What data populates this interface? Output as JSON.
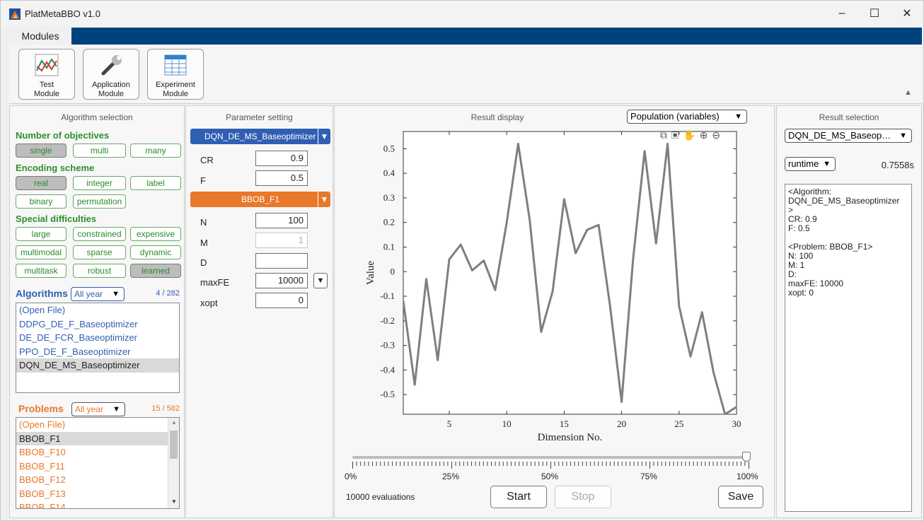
{
  "window": {
    "title": "PlatMetaBBO v1.0"
  },
  "ribbon": {
    "tab": "Modules",
    "buttons": [
      {
        "line1": "Test",
        "line2": "Module"
      },
      {
        "line1": "Application",
        "line2": "Module"
      },
      {
        "line1": "Experiment",
        "line2": "Module"
      }
    ]
  },
  "algorithm_selection": {
    "title": "Algorithm selection",
    "objectives": {
      "label": "Number of objectives",
      "tags": [
        "single",
        "multi",
        "many"
      ]
    },
    "encoding": {
      "label": "Encoding scheme",
      "tags": [
        "real",
        "integer",
        "label",
        "binary",
        "permutation"
      ]
    },
    "special": {
      "label": "Special difficulties",
      "tags": [
        "large",
        "constrained",
        "expensive",
        "multimodal",
        "sparse",
        "dynamic",
        "multitask",
        "robust",
        "learned"
      ]
    },
    "algorithms": {
      "label": "Algorithms",
      "filter": "All year",
      "count": "4 / 282",
      "items": [
        "(Open File)",
        "DDPG_DE_F_Baseoptimizer",
        "DE_DE_FCR_Baseoptimizer",
        "PPO_DE_F_Baseoptimizer",
        "DQN_DE_MS_Baseoptimizer"
      ]
    },
    "problems": {
      "label": "Problems",
      "filter": "All year",
      "count": "15 / 582",
      "items": [
        "(Open File)",
        "BBOB_F1",
        "BBOB_F10",
        "BBOB_F11",
        "BBOB_F12",
        "BBOB_F13",
        "BBOB_F14"
      ]
    }
  },
  "parameter_setting": {
    "title": "Parameter setting",
    "algorithm": "DQN_DE_MS_Baseoptimizer",
    "alg_params": [
      {
        "name": "CR",
        "value": "0.9"
      },
      {
        "name": "F",
        "value": "0.5"
      }
    ],
    "problem": "BBOB_F1",
    "prob_params": [
      {
        "name": "N",
        "value": "100"
      },
      {
        "name": "M",
        "value": "1"
      },
      {
        "name": "D",
        "value": ""
      },
      {
        "name": "maxFE",
        "value": "10000"
      },
      {
        "name": "xopt",
        "value": "0"
      }
    ]
  },
  "result_display": {
    "title": "Result display",
    "view": "Population (variables)",
    "slider_ticks": [
      "0%",
      "25%",
      "50%",
      "75%",
      "100%"
    ],
    "evaluations": "10000 evaluations",
    "start": "Start",
    "stop": "Stop",
    "save": "Save"
  },
  "chart_data": {
    "type": "line",
    "xlabel": "Dimension No.",
    "ylabel": "Value",
    "xlim": [
      1,
      30
    ],
    "ylim": [
      -0.58,
      0.57
    ],
    "xticks": [
      5,
      10,
      15,
      20,
      25,
      30
    ],
    "yticks": [
      0.5,
      0.4,
      0.3,
      0.2,
      0.1,
      0,
      -0.1,
      -0.2,
      -0.3,
      -0.4,
      -0.5
    ],
    "x": [
      1,
      2,
      3,
      4,
      5,
      6,
      7,
      8,
      9,
      10,
      11,
      12,
      13,
      14,
      15,
      16,
      17,
      18,
      19,
      20,
      21,
      22,
      23,
      24,
      25,
      26,
      27,
      28,
      29,
      30
    ],
    "y": [
      -0.12,
      -0.46,
      -0.03,
      -0.36,
      0.05,
      0.11,
      0.005,
      0.045,
      -0.075,
      0.2,
      0.52,
      0.21,
      -0.245,
      -0.08,
      0.295,
      0.075,
      0.17,
      0.19,
      -0.14,
      -0.53,
      0.05,
      0.49,
      0.115,
      0.52,
      -0.14,
      -0.345,
      -0.165,
      -0.41,
      -0.58,
      -0.55
    ],
    "color": "#7f7f7f"
  },
  "result_selection": {
    "title": "Result selection",
    "algorithm": "DQN_DE_MS_Baseop…",
    "metric": "runtime",
    "metric_value": "0.7558s",
    "info": [
      "<Algorithm:",
      "DQN_DE_MS_Baseoptimizer",
      ">",
      "CR: 0.9",
      "F: 0.5",
      "",
      "<Problem: BBOB_F1>",
      "N: 100",
      "M: 1",
      "D:",
      "maxFE: 10000",
      "xopt: 0"
    ]
  },
  "colors": {
    "accent": "#00437c",
    "algo_blue": "#2f5fb3",
    "problem_orange": "#e8782a",
    "green": "#2d8f2d"
  }
}
